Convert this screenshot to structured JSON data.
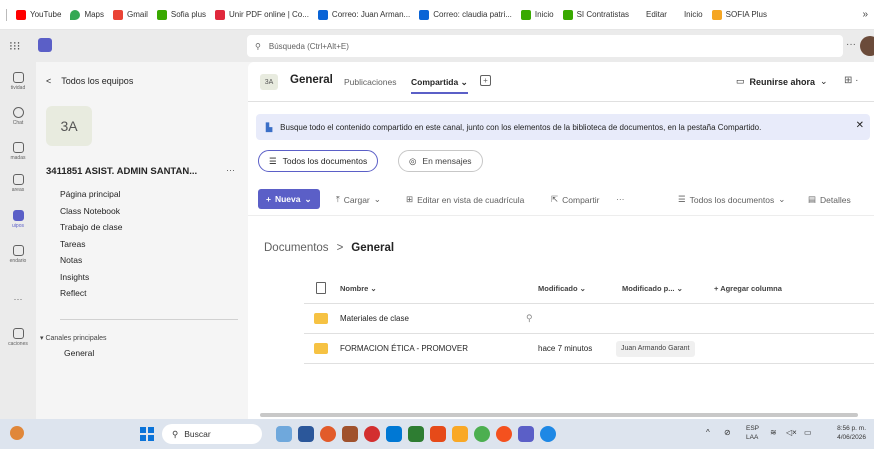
{
  "bookmarks": [
    {
      "label": "YouTube",
      "icon": "youtube-icon",
      "color": "#ff0000"
    },
    {
      "label": "Maps",
      "icon": "maps-icon",
      "color": "#34a853"
    },
    {
      "label": "Gmail",
      "icon": "gmail-icon",
      "color": "#ea4335"
    },
    {
      "label": "Sofia plus",
      "icon": "sofia-icon",
      "color": "#39a900"
    },
    {
      "label": "Unir PDF online | Co...",
      "icon": "pdf-icon",
      "color": "#e0283c"
    },
    {
      "label": "Correo: Juan Arman...",
      "icon": "outlook-icon",
      "color": "#0a64d6"
    },
    {
      "label": "Correo: claudia patri...",
      "icon": "outlook-icon",
      "color": "#0a64d6"
    },
    {
      "label": "Inicio",
      "icon": "sena-icon",
      "color": "#39a900"
    },
    {
      "label": "SI Contratistas",
      "icon": "sena-icon",
      "color": "#39a900"
    },
    {
      "label": "Editar",
      "icon": "",
      "color": ""
    },
    {
      "label": "Inicio",
      "icon": "",
      "color": ""
    },
    {
      "label": "SOFIA Plus",
      "icon": "sofia-plus-icon",
      "color": "#f5a623"
    }
  ],
  "bookmarks_more": "»",
  "search": {
    "placeholder": "Búsqueda (Ctrl+Alt+E)"
  },
  "rail": [
    {
      "label": "tividad",
      "icon": "bell-icon"
    },
    {
      "label": "Chat",
      "icon": "chat-icon"
    },
    {
      "label": "madas",
      "icon": "phone-icon"
    },
    {
      "label": "areas",
      "icon": "tasks-icon"
    },
    {
      "label": "uipos",
      "icon": "teams-icon"
    },
    {
      "label": "endario",
      "icon": "calendar-icon"
    },
    {
      "label": "···",
      "icon": "more-icon"
    },
    {
      "label": "caciones",
      "icon": "apps-icon"
    }
  ],
  "team_panel": {
    "back_label": "Todos los equipos",
    "team_initials": "3A",
    "team_name": "3411851 ASIST. ADMIN SANTAN...",
    "more": "···",
    "nav": [
      "Página principal",
      "Class Notebook",
      "Trabajo de clase",
      "Tareas",
      "Notas",
      "Insights",
      "Reflect"
    ],
    "channels_header": "Canales principales",
    "channel": "General"
  },
  "channel_header": {
    "badge": "3A",
    "title": "General",
    "tabs": [
      "Publicaciones",
      "Compartida"
    ],
    "meet_label": "Reunirse ahora"
  },
  "banner": {
    "text": "Busque todo el contenido compartido en este canal, junto con los elementos de la biblioteca de documentos, en la pestaña Compartido."
  },
  "pills": {
    "all_docs": "Todos los documentos",
    "in_messages": "En mensajes"
  },
  "commands": {
    "new": "Nueva",
    "upload": "Cargar",
    "grid_edit": "Editar en vista de cuadrícula",
    "share": "Compartir",
    "more": "···",
    "view": "Todos los documentos",
    "details": "Detalles"
  },
  "breadcrumb": {
    "root": "Documentos",
    "sep": ">",
    "current": "General"
  },
  "table": {
    "headers": {
      "name": "Nombre",
      "modified": "Modificado",
      "modified_by": "Modificado p...",
      "add_column": "Agregar columna"
    },
    "rows": [
      {
        "name": "Materiales de clase",
        "modified": "",
        "modified_by": "",
        "pinned": true
      },
      {
        "name": "FORMACION ÉTICA - PROMOVER",
        "modified": "hace 7 minutos",
        "modified_by": "Juan Armando Garant",
        "pinned": false
      }
    ]
  },
  "taskbar": {
    "search_label": "Buscar",
    "language": "ESP",
    "language_sub": "LAA",
    "time": "8:56 p. m.",
    "date": "4/06/2026"
  },
  "colors": {
    "accent": "#5b5fc7",
    "banner_bg": "#e8ebfa",
    "folder": "#f6c243"
  }
}
